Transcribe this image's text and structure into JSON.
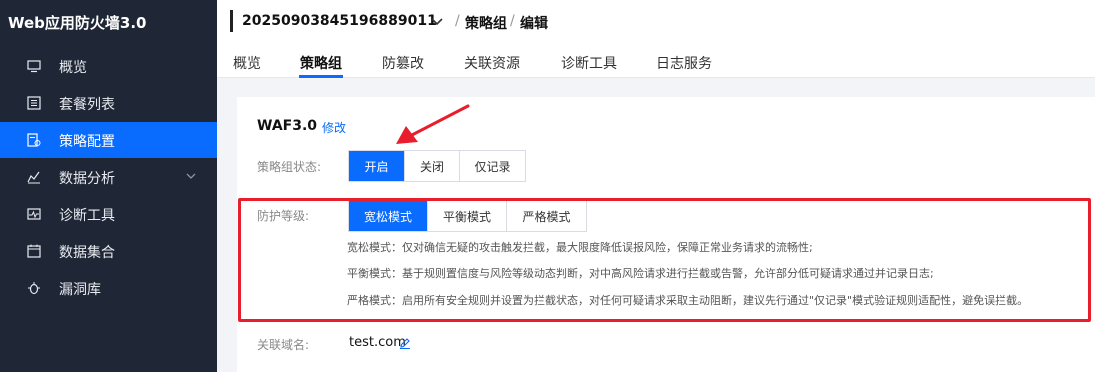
{
  "sidebar": {
    "title": "Web应用防火墙3.0",
    "items": [
      {
        "label": "概览",
        "icon": "monitor-icon"
      },
      {
        "label": "套餐列表",
        "icon": "list-icon"
      },
      {
        "label": "策略配置",
        "icon": "policy-icon"
      },
      {
        "label": "数据分析",
        "icon": "chart-icon"
      },
      {
        "label": "诊断工具",
        "icon": "diagnostic-icon"
      },
      {
        "label": "数据集合",
        "icon": "calendar-icon"
      },
      {
        "label": "漏洞库",
        "icon": "bug-icon"
      }
    ]
  },
  "header": {
    "instance_id": "20250903845196889011",
    "breadcrumb": [
      "策略组",
      "编辑"
    ],
    "tabs": [
      "概览",
      "策略组",
      "防篡改",
      "关联资源",
      "诊断工具",
      "日志服务"
    ]
  },
  "policy": {
    "name": "WAF3.0",
    "edit_label": "修改",
    "status_label": "策略组状态:",
    "status_options": [
      "开启",
      "关闭",
      "仅记录"
    ],
    "level_label": "防护等级:",
    "level_options": [
      "宽松模式",
      "平衡模式",
      "严格模式"
    ],
    "descriptions": [
      "宽松模式：仅对确信无疑的攻击触发拦截，最大限度降低误报风险，保障正常业务请求的流畅性;",
      "平衡模式：基于规则置信度与风险等级动态判断，对中高风险请求进行拦截或告警，允许部分低可疑请求通过并记录日志;",
      "严格模式：启用所有安全规则并设置为拦截状态，对任何可疑请求采取主动阻断，建议先行通过\"仅记录\"模式验证规则适配性，避免误拦截。"
    ],
    "domain_label": "关联域名:",
    "domain_value": "test.com"
  },
  "colors": {
    "accent": "#0a6cff",
    "sidebar_bg": "#1f2736",
    "annotation": "#e81e2c"
  }
}
